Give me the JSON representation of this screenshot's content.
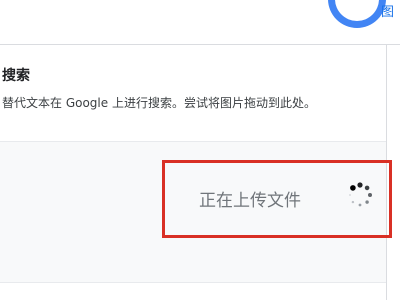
{
  "header": {
    "corner_label": "图"
  },
  "search_by_image": {
    "title": "搜索",
    "description": "替代文本在 Google 上进行搜索。尝试将图片拖动到此处。"
  },
  "upload": {
    "status_text": "正在上传文件",
    "spinner_icon": "loading-spinner-icon"
  },
  "colors": {
    "brand_blue": "#4285f4",
    "highlight_red": "#d93025",
    "status_gray": "#70757a"
  }
}
